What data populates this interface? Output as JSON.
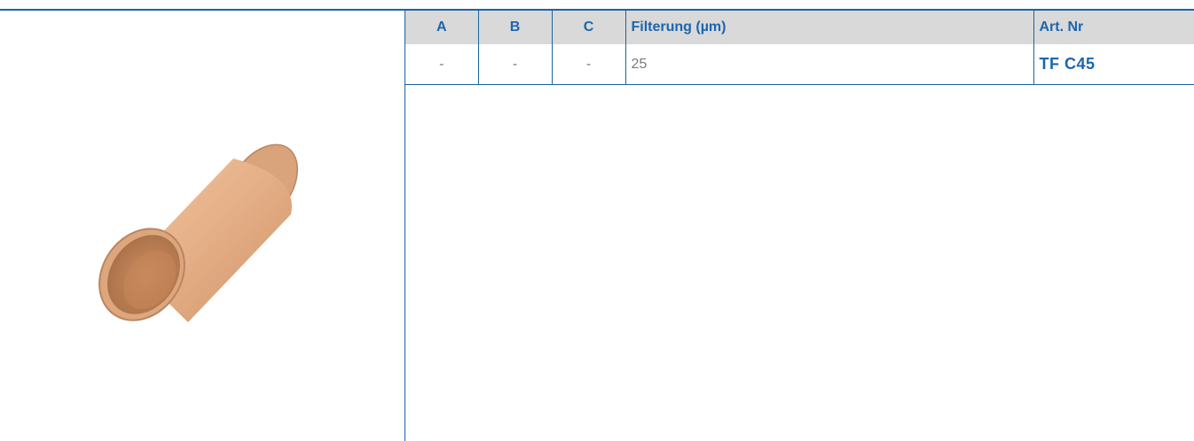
{
  "table": {
    "headers": [
      "A",
      "B",
      "C",
      "Filterung (µm)",
      "Art. Nr"
    ],
    "row": {
      "a": "-",
      "b": "-",
      "c": "-",
      "filterung": "25",
      "art_nr": "TF C45"
    }
  },
  "image": {
    "icon": "sintered-bronze-filter-cylinder",
    "colors": {
      "bronze_light": "#e8b690",
      "bronze_mid": "#d9a079",
      "bronze_dark": "#b47a52",
      "accent": "#1a63a8",
      "header_bg": "#d9d9d9"
    }
  }
}
